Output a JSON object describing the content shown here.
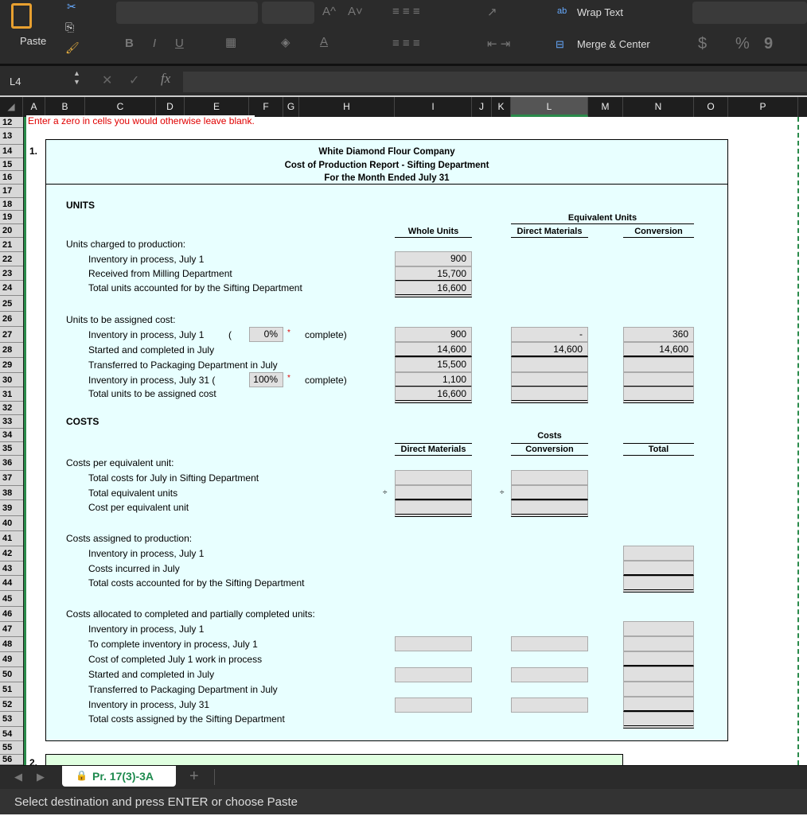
{
  "ribbon": {
    "paste": "Paste",
    "wrap_text": "Wrap Text",
    "merge_center": "Merge & Center",
    "bold": "B",
    "italic": "I",
    "underline": "U",
    "currency": "$",
    "percent": "%",
    "comma": "9",
    "font_grow": "A^",
    "font_shrink": "A˅"
  },
  "formula_bar": {
    "cell_ref": "L4",
    "fx": "fx",
    "value": ""
  },
  "columns": [
    "A",
    "B",
    "C",
    "D",
    "E",
    "F",
    "G",
    "H",
    "I",
    "J",
    "K",
    "L",
    "M",
    "N",
    "O",
    "P"
  ],
  "selected_column": "L",
  "rows": [
    "12",
    "13",
    "14",
    "15",
    "16",
    "17",
    "18",
    "19",
    "20",
    "21",
    "22",
    "23",
    "24",
    "25",
    "26",
    "27",
    "28",
    "29",
    "30",
    "31",
    "32",
    "33",
    "34",
    "35",
    "36",
    "37",
    "38",
    "39",
    "40",
    "41",
    "42",
    "43",
    "44",
    "45",
    "46",
    "47",
    "48",
    "49",
    "50",
    "51",
    "52",
    "53",
    "54",
    "55",
    "56"
  ],
  "instruction": "Enter a zero in cells you would otherwise leave blank.",
  "problem_1": "1.",
  "problem_2": "2.",
  "report": {
    "company": "White Diamond Flour Company",
    "title": "Cost of Production Report - Sifting Department",
    "period": "For the Month Ended July 31",
    "units_heading": "UNITS",
    "equiv_units": "Equivalent Units",
    "whole_units": "Whole Units",
    "direct_materials": "Direct Materials",
    "conversion": "Conversion",
    "charged_label": "Units charged to production:",
    "inv_july1": "Inventory in process, July 1",
    "received": "Received from Milling Department",
    "total_accounted": "Total units accounted for by the Sifting Department",
    "charged_values": [
      "900",
      "15,700",
      "16,600"
    ],
    "assigned_label": "Units to be assigned cost:",
    "inv_july1_pct": "0%",
    "inv_july31_pct": "100%",
    "open_paren": "(",
    "complete": "complete)",
    "asterisk": "*",
    "started_completed": "Started and completed in July",
    "transferred": "Transferred to Packaging Department in July",
    "inv_july31": "Inventory in process, July 31 (",
    "total_assigned": "Total units to be assigned cost",
    "whole_values": [
      "900",
      "14,600",
      "15,500",
      "1,100",
      "16,600"
    ],
    "dm_values": [
      "-",
      "14,600",
      "",
      "",
      ""
    ],
    "conv_values": [
      "360",
      "14,600",
      "",
      "",
      ""
    ],
    "costs_heading": "COSTS",
    "costs": "Costs",
    "total": "Total",
    "cpeu_label": "Costs per equivalent unit:",
    "total_costs_july": "Total costs for July in Sifting Department",
    "total_eu": "Total equivalent units",
    "cost_per_eu": "Cost per equivalent unit",
    "divide": "÷",
    "assigned_prod_label": "Costs assigned to production:",
    "inv_july1_c": "Inventory in process, July 1",
    "costs_incurred": "Costs incurred in July",
    "total_costs_accounted": "Total costs accounted for by the Sifting Department",
    "allocated_label": "Costs allocated to completed and partially completed units:",
    "alloc_inv_july1": "Inventory in process, July 1",
    "to_complete": "To complete inventory in process, July 1",
    "cost_completed_july1": "Cost of completed July 1 work in process",
    "alloc_started": "Started and completed in July",
    "alloc_transferred": "Transferred to Packaging Department in July",
    "alloc_inv_july31": "Inventory in process, July 31",
    "total_costs_assigned": "Total costs assigned by the Sifting Department"
  },
  "sheet_tab": "Pr. 17(3)-3A",
  "status": "Select destination and press ENTER or choose Paste",
  "colors": {
    "ribbon": "#2b2b2b",
    "box_bg": "#e8ffff",
    "input": "#e0e0e0",
    "instruction": "#e00000",
    "tab_text": "#1e8a4e"
  }
}
